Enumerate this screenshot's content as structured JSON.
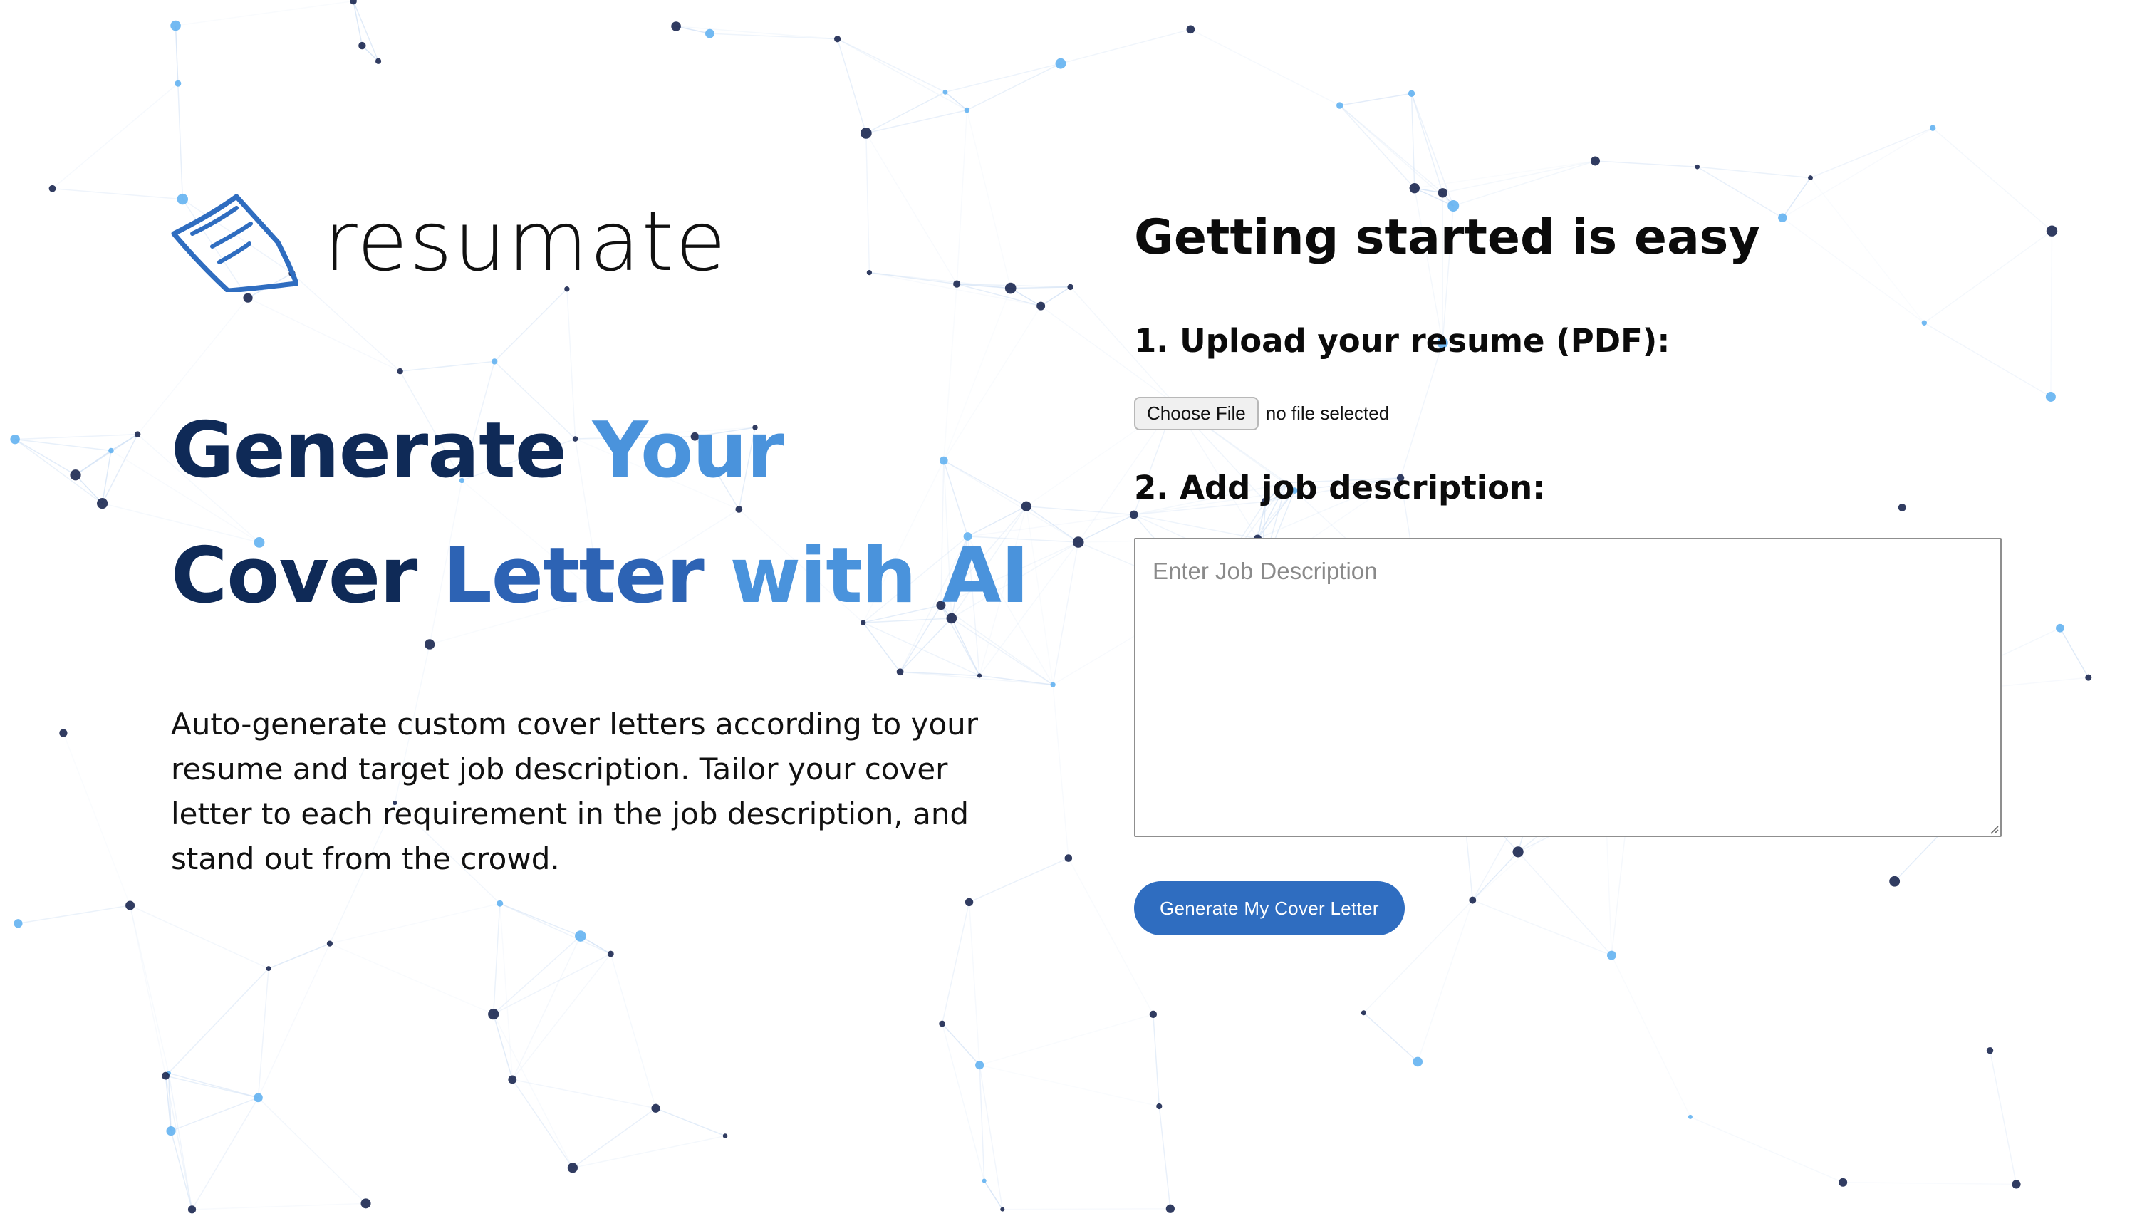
{
  "brand": {
    "name": "resumate",
    "logo_icon": "paper-letter-icon",
    "logo_color": "#2f6dc0"
  },
  "hero": {
    "line1": {
      "part1": "Generate ",
      "part2": "Your"
    },
    "line2": {
      "part1": "Cover ",
      "part2": "Letter ",
      "part3": "with AI"
    }
  },
  "description": "Auto-generate custom cover letters according to your resume and target job description. Tailor your cover letter to each requirement in the job description, and stand out from the crowd.",
  "steps": {
    "title": "Getting started is easy",
    "step1_label": "1. Upload your resume (PDF):",
    "file_button_label": "Choose File",
    "file_status": "no file selected",
    "step2_label": "2. Add job description:",
    "job_description_value": "",
    "job_description_placeholder": "Enter Job Description",
    "generate_button_label": "Generate My Cover Letter"
  },
  "colors": {
    "accent": "#2f6dc0",
    "hero_dark": "#0f2a57",
    "hero_mid": "#2d63b4",
    "hero_light": "#4a93dc",
    "network_line": "#cfe0f5",
    "network_dot_dark": "#0d1a45",
    "network_dot_light": "#5aaef0"
  }
}
